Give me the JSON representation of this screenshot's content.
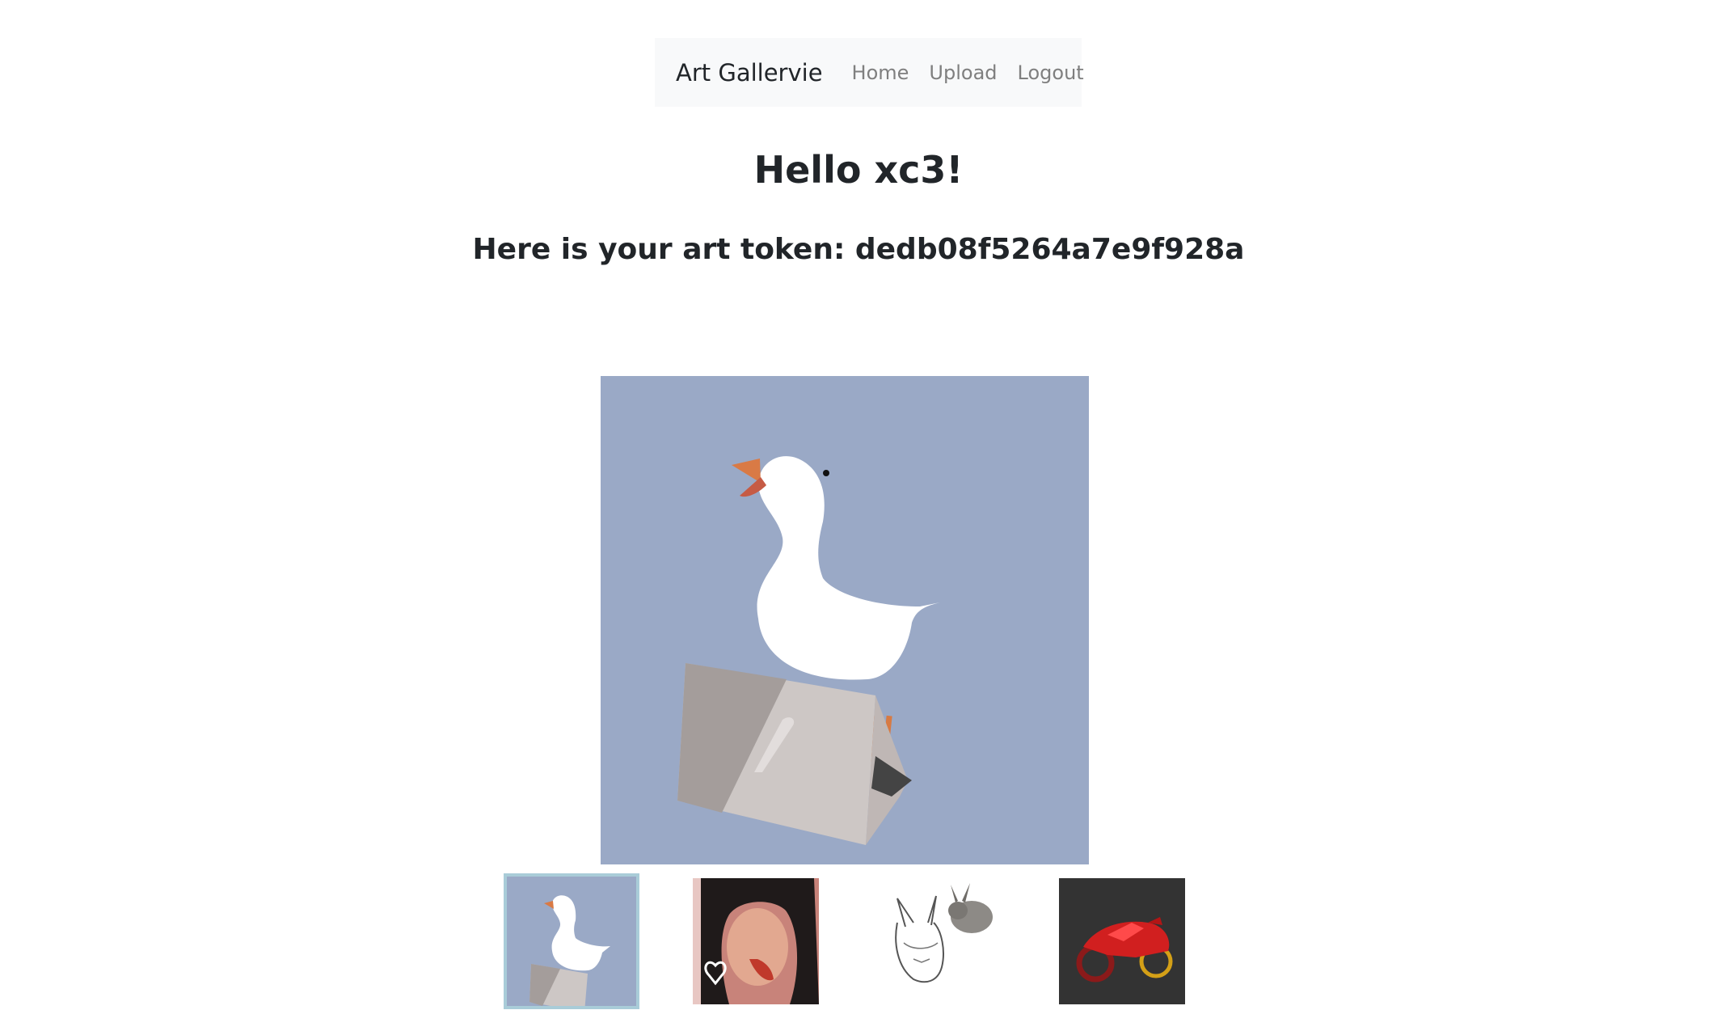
{
  "navbar": {
    "brand": "Art Gallervie",
    "links": [
      "Home",
      "Upload",
      "Logout"
    ]
  },
  "greeting": "Hello xc3!",
  "token_line": "Here is your art token: dedb08f5264a7e9f928a",
  "gallery": {
    "selected_index": 0,
    "thumbnails": [
      "goose-art",
      "portrait-art",
      "bunny-sketch-art",
      "motorcycle-art"
    ]
  }
}
